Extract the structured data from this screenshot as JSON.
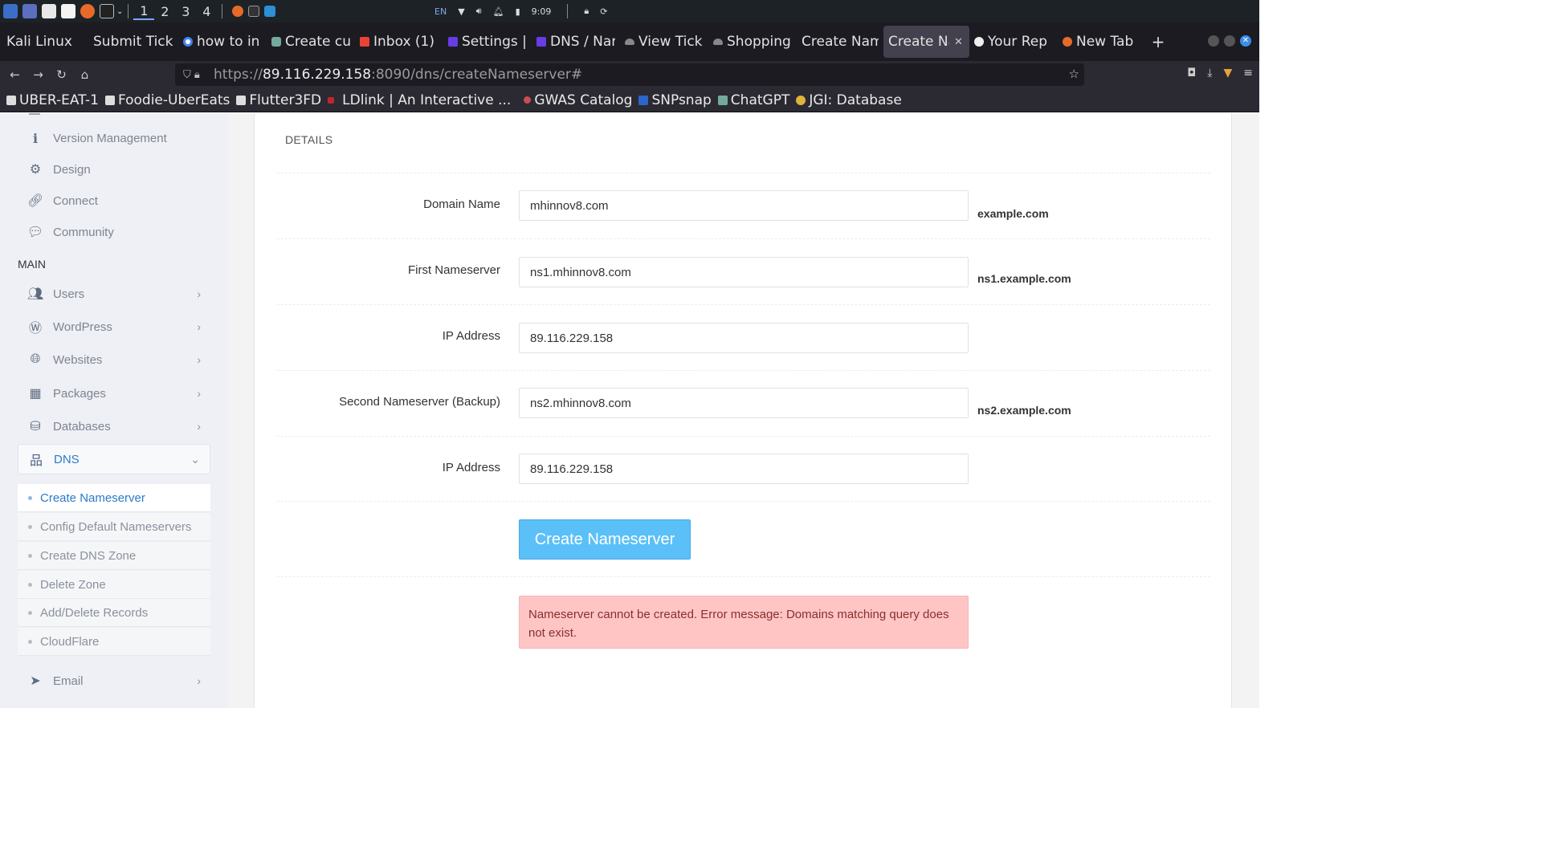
{
  "taskbar": {
    "workspaces": [
      "1",
      "2",
      "3",
      "4"
    ],
    "lang": "EN",
    "clock": "9:09"
  },
  "tabs": [
    {
      "title": "Kali Linux"
    },
    {
      "title": "Submit Tick"
    },
    {
      "title": "how to in"
    },
    {
      "title": "Create cu"
    },
    {
      "title": "Inbox (1) -"
    },
    {
      "title": "Settings |"
    },
    {
      "title": "DNS / Nar"
    },
    {
      "title": "View Tick"
    },
    {
      "title": "Shopping"
    },
    {
      "title": "Create Nam"
    },
    {
      "title": "Create Na"
    },
    {
      "title": "Your Rep"
    },
    {
      "title": "New Tab"
    }
  ],
  "url": {
    "scheme": "https://",
    "host": "89.116.229.158",
    "rest": ":8090/dns/createNameserver#"
  },
  "bookmarks": [
    {
      "label": "UBER-EAT-1"
    },
    {
      "label": "Foodie-UberEats"
    },
    {
      "label": "Flutter3FD"
    },
    {
      "label": "LDlink | An Interactive ..."
    },
    {
      "label": "GWAS Catalog"
    },
    {
      "label": "SNPsnap"
    },
    {
      "label": "ChatGPT"
    },
    {
      "label": "JGI: Database"
    }
  ],
  "sidebar": {
    "top_items": [
      {
        "label": "Version Management"
      },
      {
        "label": "Design"
      },
      {
        "label": "Connect"
      },
      {
        "label": "Community"
      }
    ],
    "section_heading": "MAIN",
    "main_items": [
      {
        "label": "Users"
      },
      {
        "label": "WordPress"
      },
      {
        "label": "Websites"
      },
      {
        "label": "Packages"
      },
      {
        "label": "Databases"
      },
      {
        "label": "DNS"
      }
    ],
    "dns_subitems": [
      {
        "label": "Create Nameserver"
      },
      {
        "label": "Config Default Nameservers"
      },
      {
        "label": "Create DNS Zone"
      },
      {
        "label": "Delete Zone"
      },
      {
        "label": "Add/Delete Records"
      },
      {
        "label": "CloudFlare"
      }
    ],
    "email_item": {
      "label": "Email"
    }
  },
  "form": {
    "section_title": "DETAILS",
    "rows": [
      {
        "label": "Domain Name",
        "value": "mhinnov8.com",
        "hint": "example.com"
      },
      {
        "label": "First Nameserver",
        "value": "ns1.mhinnov8.com",
        "hint": "ns1.example.com"
      },
      {
        "label": "IP Address",
        "value": "89.116.229.158",
        "hint": ""
      },
      {
        "label": "Second Nameserver (Backup)",
        "value": "ns2.mhinnov8.com",
        "hint": "ns2.example.com"
      },
      {
        "label": "IP Address",
        "value": "89.116.229.158",
        "hint": ""
      }
    ],
    "submit_label": "Create Nameserver",
    "error_message": "Nameserver cannot be created. Error message: Domains matching query does not exist."
  },
  "colors": {
    "accent": "#2a7bc9",
    "button": "#5bc0f8",
    "error_bg": "#ffc5c5"
  }
}
